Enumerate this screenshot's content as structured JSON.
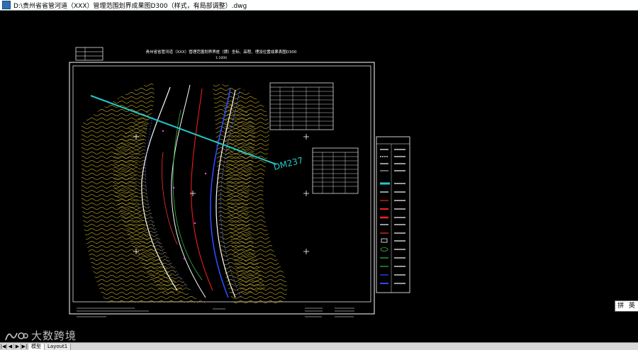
{
  "window": {
    "title": "D:\\贵州省省管河道（XXX）管理范围划界成果图D300（样式，有局部调整）.dwg"
  },
  "drawing": {
    "sheet_title": "贵州省省管河道（XXX）管理范围划界界桩（牌）坐标、高程、埋设位置成果表图D300",
    "scale": "1:1000",
    "section_label": "DM237"
  },
  "colors": {
    "background": "#000000",
    "frame": "#ffffff",
    "contour": "#b8a020",
    "section_line": "#25c6c6",
    "river": "#2a4bff",
    "boundary": "#ff2020"
  },
  "status_bar": {
    "nav_buttons": [
      "|◀",
      "◀",
      "▶",
      "▶|"
    ],
    "tabs": [
      "模型",
      "Layout1"
    ]
  },
  "ime": {
    "label": "拼 英"
  },
  "watermark": {
    "text": "大数跨境"
  }
}
